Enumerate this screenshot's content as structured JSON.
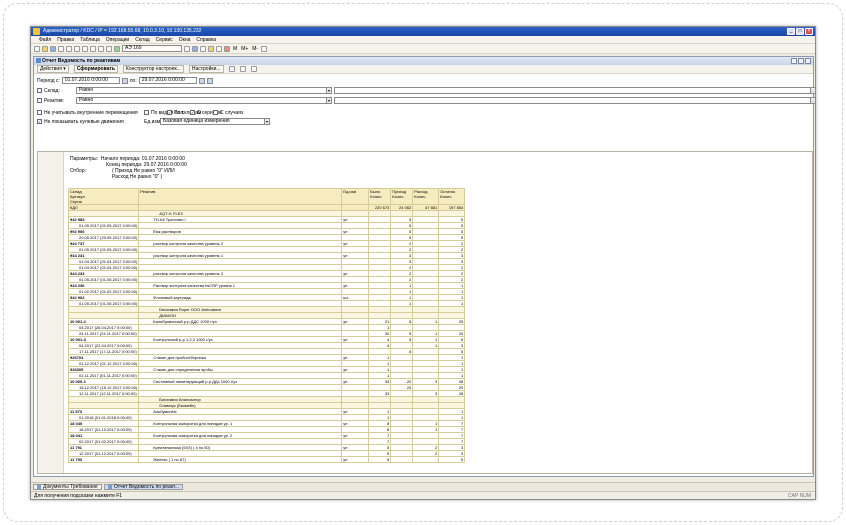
{
  "window": {
    "title": "Администратор / KDC / IP = 192.168.50.68, 10.0.3.10, 10.130.135.232"
  },
  "menu": [
    "Файл",
    "Правка",
    "Таблица",
    "Операции",
    "Склад",
    "Сервис",
    "Окна",
    "Справка"
  ],
  "toolbar": {
    "search_value": "АЭ 169",
    "btn_m": "M",
    "btn_mplus": "M+",
    "btn_mminus": "M-"
  },
  "document": {
    "title": "Отчет  Ведомость по реактивам"
  },
  "actions": {
    "actions": "Действия ▾",
    "generate": "Сформировать",
    "designer": "Конструктор настроек...",
    "settings": "Настройки..."
  },
  "period": {
    "label": "Период с:",
    "from": "01.07.2016  0:00:00",
    "to_label": "по:",
    "to": "29.07.2016  0:00:00"
  },
  "filters": [
    {
      "label": "Склад:",
      "checked": false,
      "condition": "Равно"
    },
    {
      "label": "Реактив:",
      "checked": false,
      "condition": "Равно"
    }
  ],
  "options": {
    "internal_moves": "Не учитывать внутренние перемещения",
    "zero_moves": "Не показывать нулевые движения",
    "by_series": "По видам опл.",
    "by_warehouses": "По складам",
    "with_serials": "С сериями",
    "with_cases": "С случаях",
    "unit_label": "Ед.изм:",
    "unit_value": "Базовая единица измерения"
  },
  "params": {
    "label": "Параметры:",
    "line1": "Начало периода: 01.07.2016 0:00:00",
    "line2": "Конец периода: 29.07.2016 0:00:00",
    "filter_label": "Отбор:",
    "filter1": "( Приход Не равно \"0\" ИЛИ",
    "filter2": "Расход Не равно \"0\" )"
  },
  "table": {
    "headers": {
      "h1": "Склад",
      "h2": "Артикул",
      "h3": "Серия",
      "reagent": "Реактив",
      "unit": "Ед.изм",
      "was": "Было\nКолич",
      "in": "Приход\nКолич",
      "out": "Расход\nКолич",
      "rest": "Остаток\nКолич"
    },
    "rows": [
      {
        "t": "total",
        "c1": "КДЛ",
        "c2": "",
        "u": "",
        "a": "220 673",
        "b": "24 062",
        "c": "47 881",
        "d": "197 854"
      },
      {
        "t": "grp",
        "c1": "",
        "c2": "AQT-9: FLEX",
        "u": "",
        "a": "",
        "b": "",
        "c": "",
        "d": ""
      },
      {
        "t": "item",
        "c1": "942 983",
        "c2": "TH-Kit Тропонин I",
        "u": "уп",
        "a": "",
        "b": "5",
        "c": "",
        "d": "5"
      },
      {
        "t": "sub",
        "c1": "01.05.2017 (01.05.2017 0:00:00)",
        "c2": "",
        "u": "",
        "a": "",
        "b": "5",
        "c": "",
        "d": "5"
      },
      {
        "t": "item",
        "c1": "992 906",
        "c2": "Ёмк растворов",
        "u": "уп",
        "a": "",
        "b": "5",
        "c": "",
        "d": "5"
      },
      {
        "t": "sub",
        "c1": "20.05.2017 (20.05.2017 0:00:00)",
        "c2": "",
        "u": "",
        "a": "",
        "b": "5",
        "c": "",
        "d": "5"
      },
      {
        "t": "item",
        "c1": "944 737",
        "c2": "раствор контроля качества уровень 2",
        "u": "уп",
        "a": "",
        "b": "2",
        "c": "",
        "d": "2"
      },
      {
        "t": "sub",
        "c1": "01.05.2017 (01.05.2017 0:00:00)",
        "c2": "",
        "u": "",
        "a": "",
        "b": "2",
        "c": "",
        "d": "2"
      },
      {
        "t": "item",
        "c1": "944 231",
        "c2": "раствор контроля качества уровень 1",
        "u": "уп",
        "a": "",
        "b": "3",
        "c": "",
        "d": "3"
      },
      {
        "t": "sub",
        "c1": "01.04.2017 (01.04.2017 0:00:00)",
        "c2": "",
        "u": "",
        "a": "",
        "b": "3",
        "c": "",
        "d": "3"
      },
      {
        "t": "sub",
        "c1": "01.04.2017 (01.04.2017 0:00:00)",
        "c2": "",
        "u": "",
        "a": "",
        "b": "2",
        "c": "",
        "d": "2"
      },
      {
        "t": "item",
        "c1": "944 233",
        "c2": "раствор контроля качества уровень 3",
        "u": "уп",
        "a": "",
        "b": "2",
        "c": "",
        "d": "2"
      },
      {
        "t": "sub",
        "c1": "01.05.2017 (01.05.2017 0:00:00)",
        "c2": "",
        "u": "",
        "a": "",
        "b": "2",
        "c": "",
        "d": "2"
      },
      {
        "t": "item",
        "c1": "944 236",
        "c2": "Раствор контроля качества hsCRP уровня 1",
        "u": "уп",
        "a": "",
        "b": "1",
        "c": "",
        "d": "1"
      },
      {
        "t": "sub",
        "c1": "01.02.2017 (01.02.2017 0:00:00)",
        "c2": "",
        "u": "",
        "a": "",
        "b": "1",
        "c": "",
        "d": "1"
      },
      {
        "t": "item",
        "c1": "942 962",
        "c2": "Флоновый картридж",
        "u": "шт.",
        "a": "",
        "b": "1",
        "c": "",
        "d": "1"
      },
      {
        "t": "sub",
        "c1": "01.05.2017 (01.05.2017 0:00:00)",
        "c2": "",
        "u": "",
        "a": "",
        "b": "1",
        "c": "",
        "d": "1"
      },
      {
        "t": "grp",
        "c1": "",
        "c2": "Биохимия Roper ООО Ambulance",
        "u": "",
        "a": "",
        "b": "",
        "c": "",
        "d": ""
      },
      {
        "t": "grp",
        "c1": "",
        "c2": "ДИАКОН",
        "u": "",
        "a": "",
        "b": "",
        "c": "",
        "d": ""
      },
      {
        "t": "item",
        "c1": "10 001-2",
        "c2": "Калибровочный р-р  ДДС 1000 г/уз",
        "u": "уп",
        "a": "21",
        "b": "5",
        "c": "1",
        "d": "25"
      },
      {
        "t": "sub",
        "c1": "04.2017 (26.04.2017 0:00:00)",
        "c2": "",
        "u": "",
        "a": "1",
        "b": "",
        "c": "",
        "d": ""
      },
      {
        "t": "sub",
        "c1": "24.11.2017 (24.11.2017 0:00:00)",
        "c2": "",
        "u": "",
        "a": "20",
        "b": "5",
        "c": "1",
        "d": "24"
      },
      {
        "t": "item",
        "c1": "10 001-3",
        "c2": "Контрольный р-р  1,2,3 1000 г/уз",
        "u": "уп",
        "a": "4",
        "b": "5",
        "c": "1",
        "d": "8"
      },
      {
        "t": "sub",
        "c1": "04.2017 (22.04.2017 0:00:00)",
        "c2": "",
        "u": "",
        "a": "4",
        "b": "",
        "c": "1",
        "d": "3"
      },
      {
        "t": "sub",
        "c1": "17.11.2017 (17.11.2017 0:00:00)",
        "c2": "",
        "u": "",
        "a": "",
        "b": "5",
        "c": "",
        "d": "5"
      },
      {
        "t": "item",
        "c1": "926704",
        "c2": "Стакан для пробоотборника",
        "u": "уп",
        "a": "1",
        "b": "",
        "c": "",
        "d": "1"
      },
      {
        "t": "sub",
        "c1": "01.12.2017 (01.12.2017 0:00:00)",
        "c2": "",
        "u": "",
        "a": "1",
        "b": "",
        "c": "",
        "d": "1"
      },
      {
        "t": "item",
        "c1": "926305",
        "c2": "Стакан для определения пробы",
        "u": "уп",
        "a": "1",
        "b": "",
        "c": "",
        "d": "1"
      },
      {
        "t": "sub",
        "c1": "01.11.2017 (01.11.2017 0:00:00)",
        "c2": "",
        "u": "",
        "a": "1",
        "b": "",
        "c": "",
        "d": "1"
      },
      {
        "t": "item",
        "c1": "10 000-1",
        "c2": "Системный лимитирующий р-р ДДс 1000 г/уз",
        "u": "уп",
        "a": "33",
        "b": "20",
        "c": "3",
        "d": "48"
      },
      {
        "t": "sub",
        "c1": "15.12.2017 (15.12.2017 0:00:00)",
        "c2": "",
        "u": "",
        "a": "",
        "b": "20",
        "c": "",
        "d": "20"
      },
      {
        "t": "sub",
        "c1": "12.11.2017 (12.11.2017 0:00:00)",
        "c2": "",
        "u": "",
        "a": "33",
        "b": "",
        "c": "3",
        "d": "28"
      },
      {
        "t": "grp",
        "c1": "",
        "c2": "Биохимия Анализатор",
        "u": "",
        "a": "",
        "b": "",
        "c": "",
        "d": ""
      },
      {
        "t": "grp",
        "c1": "",
        "c2": "Олимпус (Бекмейн)",
        "u": "",
        "a": "",
        "b": "",
        "c": "",
        "d": ""
      },
      {
        "t": "item",
        "c1": "11 573",
        "c2": "АльбуминNx",
        "u": "уп",
        "a": "1",
        "b": "",
        "c": "",
        "d": "1"
      },
      {
        "t": "sub",
        "c1": "01.2018 (01.01.2018 0:00:00)",
        "c2": "",
        "u": "",
        "a": "1",
        "b": "",
        "c": "",
        "d": "1"
      },
      {
        "t": "item",
        "c1": "18 040",
        "c2": "Контрольная сыворотка для липидов  ур. 1",
        "u": "уп",
        "a": "8",
        "b": "",
        "c": "1",
        "d": "7"
      },
      {
        "t": "sub",
        "c1": "18.2017 (01.10.2017 0:00:00)",
        "c2": "",
        "u": "",
        "a": "8",
        "b": "",
        "c": "1",
        "d": "7"
      },
      {
        "t": "item",
        "c1": "18 041",
        "c2": "Контрольная сыворотка для липидов  ур. 2",
        "u": "уп",
        "a": "7",
        "b": "",
        "c": "",
        "d": "7"
      },
      {
        "t": "sub",
        "c1": "02.2017 (01.02.2017 0:00:00)",
        "c2": "",
        "u": "",
        "a": "7",
        "b": "",
        "c": "",
        "d": "7"
      },
      {
        "t": "item",
        "c1": "11 791",
        "c2": "Креатинкиназа (5ХЗ) ( 4 по 50)",
        "u": "уп",
        "a": "5",
        "b": "",
        "c": "2",
        "d": "3"
      },
      {
        "t": "sub",
        "c1": "12.2017 (01.12.2017 0:00:00)",
        "c2": "",
        "u": "",
        "a": "5",
        "b": "",
        "c": "2",
        "d": "3"
      },
      {
        "t": "item",
        "c1": "11 793",
        "c2": "Железо ( 1 по 67)",
        "u": "уп",
        "a": "5",
        "b": "",
        "c": "",
        "d": "5"
      }
    ]
  },
  "taskbar": [
    "Документы Требование",
    "Отчет  Ведомость по реакт..."
  ],
  "status": {
    "text": "Для получения подсказки нажмите F1",
    "right": "CAP  NUM"
  }
}
